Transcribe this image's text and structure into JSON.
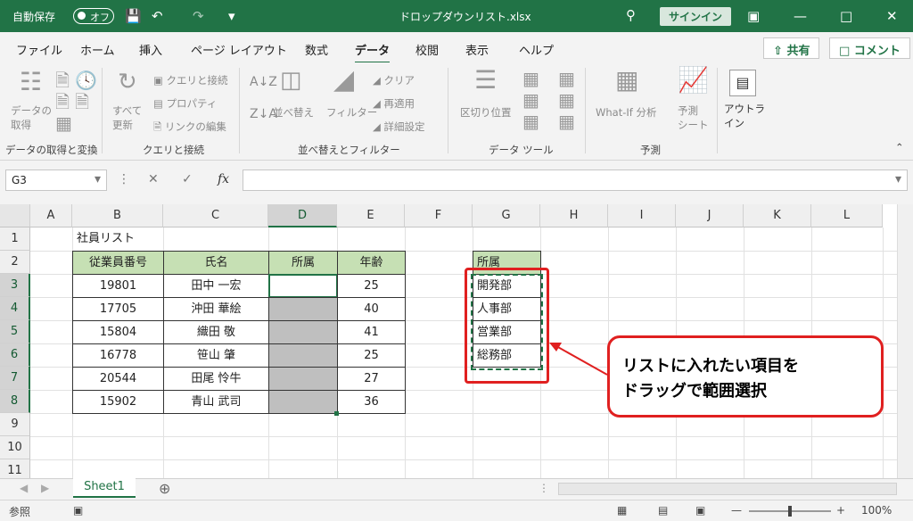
{
  "titlebar": {
    "autosave_label": "自動保存",
    "autosave_state": "オフ",
    "filename": "ドロップダウンリスト.xlsx",
    "signin": "サインイン"
  },
  "ribbon_tabs": [
    "ファイル",
    "ホーム",
    "挿入",
    "ページ レイアウト",
    "数式",
    "データ",
    "校閲",
    "表示",
    "ヘルプ"
  ],
  "active_tab": "データ",
  "share_label": "共有",
  "comment_label": "コメント",
  "ribbon": {
    "get_data": "データの\n取得",
    "refresh_all": "すべて\n更新",
    "queries": "クエリと接続",
    "properties": "プロパティ",
    "edit_links": "リンクの編集",
    "sort": "並べ替え",
    "filter": "フィルター",
    "clear": "クリア",
    "reapply": "再適用",
    "advanced": "詳細設定",
    "text_to_columns": "区切り位置",
    "what_if": "What-If 分析",
    "forecast_sheet": "予測\nシート",
    "outline": "アウトラ\nイン",
    "groups": [
      "データの取得と変換",
      "クエリと接続",
      "並べ替えとフィルター",
      "データ ツール",
      "予測"
    ]
  },
  "formula_bar": {
    "cell_ref": "G3",
    "fx": "fx"
  },
  "columns": [
    "A",
    "B",
    "C",
    "D",
    "E",
    "F",
    "G",
    "H",
    "I",
    "J",
    "K",
    "L"
  ],
  "rows": [
    "1",
    "2",
    "3",
    "4",
    "5",
    "6",
    "7",
    "8",
    "9",
    "10",
    "11"
  ],
  "sheet": {
    "title": "社員リスト",
    "headers": [
      "従業員番号",
      "氏名",
      "所属",
      "年齢"
    ],
    "records": [
      [
        "19801",
        "田中 一宏",
        "",
        "25"
      ],
      [
        "17705",
        "沖田 華絵",
        "",
        "40"
      ],
      [
        "15804",
        "織田 敬",
        "",
        "41"
      ],
      [
        "16778",
        "笹山 肇",
        "",
        "25"
      ],
      [
        "20544",
        "田尾 怜牛",
        "",
        "27"
      ],
      [
        "15902",
        "青山 武司",
        "",
        "36"
      ]
    ],
    "list_header": "所属",
    "list_items": [
      "開発部",
      "人事部",
      "営業部",
      "総務部"
    ]
  },
  "callout": {
    "line1": "リストに入れたい項目を",
    "line2": "ドラッグで範囲選択"
  },
  "sheet_tab": "Sheet1",
  "status": {
    "mode": "参照",
    "zoom": "100%"
  },
  "accent_color": "#217346",
  "annotation_color": "#e02020"
}
